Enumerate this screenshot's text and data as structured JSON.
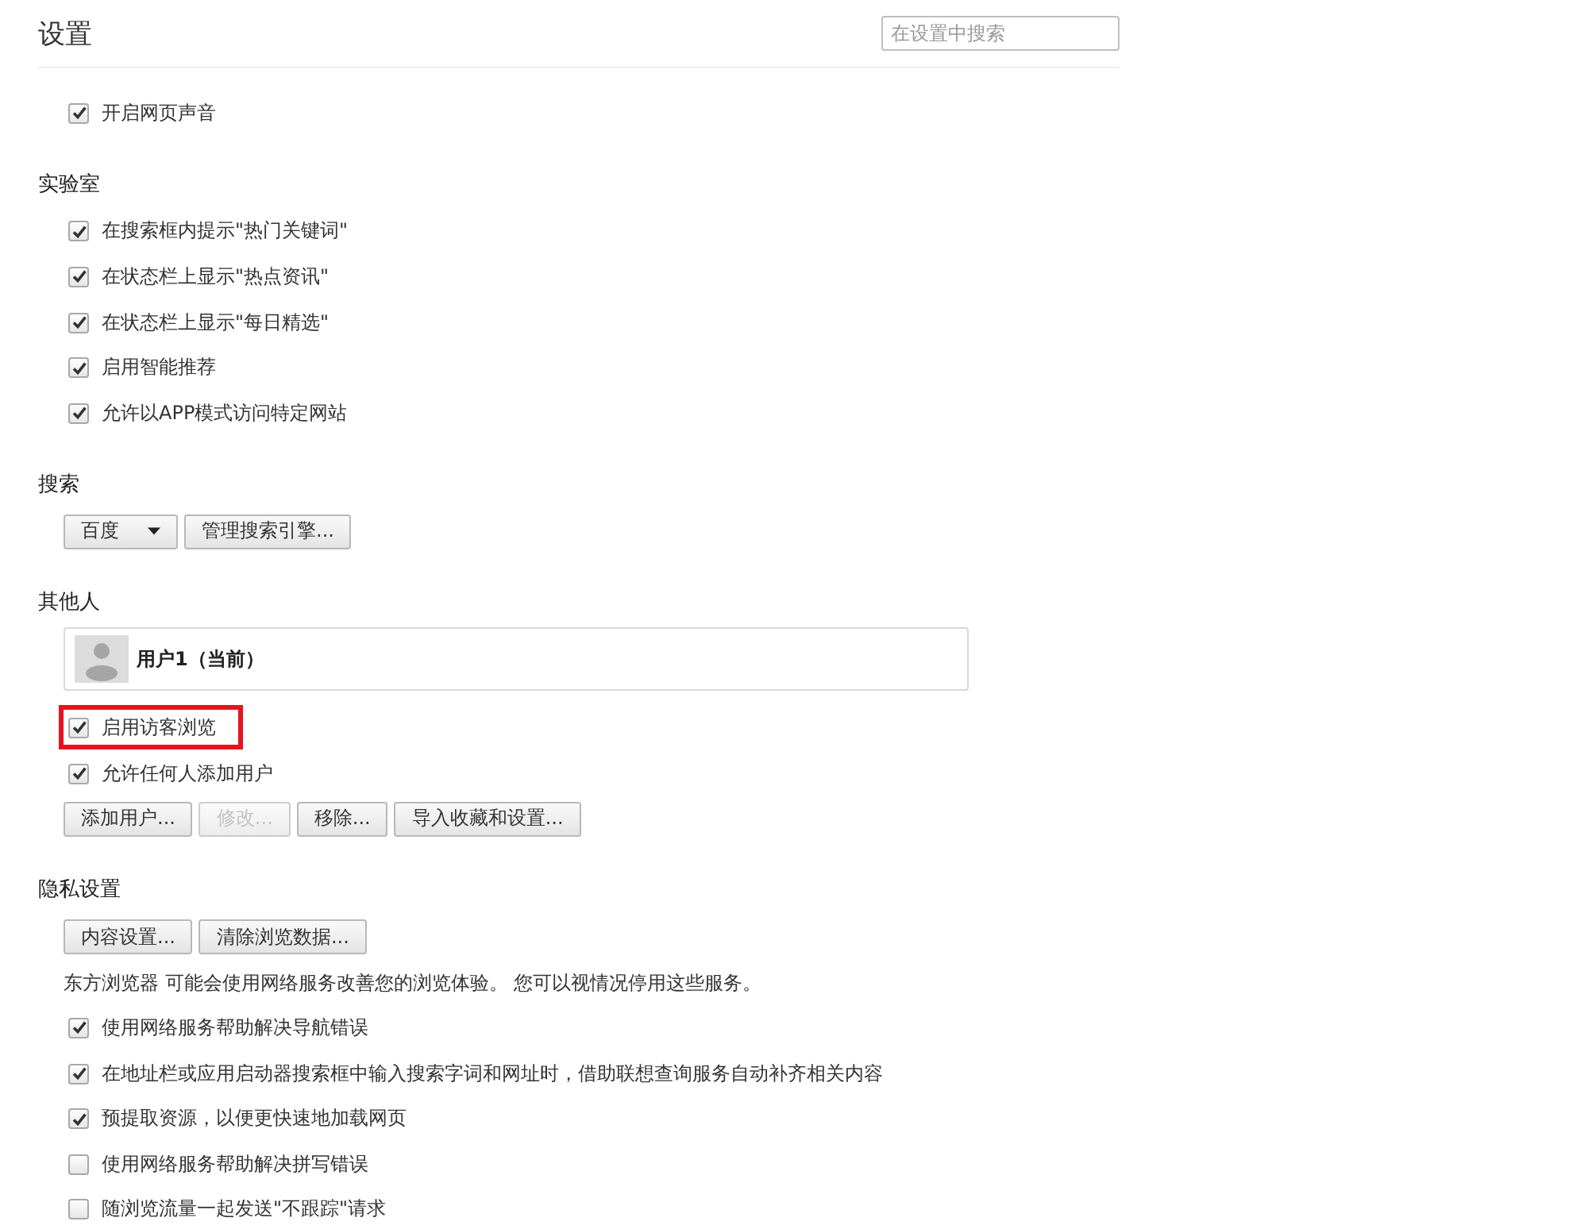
{
  "header": {
    "title": "设置",
    "search": {
      "placeholder": "在设置中搜索"
    }
  },
  "sections": [
    {
      "items": [
        {
          "kind": "checkbox",
          "label": "开启网页声音",
          "checked": true
        }
      ]
    },
    {
      "title": "实验室",
      "items": [
        {
          "kind": "checkbox",
          "label": "在搜索框内提示\"热门关键词\"",
          "checked": true
        },
        {
          "kind": "checkbox",
          "label": "在状态栏上显示\"热点资讯\"",
          "checked": true
        },
        {
          "kind": "checkbox",
          "label": "在状态栏上显示\"每日精选\"",
          "checked": true
        },
        {
          "kind": "checkbox",
          "label": "启用智能推荐",
          "checked": true
        },
        {
          "kind": "checkbox",
          "label": "允许以APP模式访问特定网站",
          "checked": true
        }
      ]
    },
    {
      "title": "搜索",
      "items": [
        {
          "kind": "buttons",
          "buttons": [
            {
              "kind": "dropdown",
              "label": "百度",
              "disabled": false
            },
            {
              "kind": "button",
              "label": "管理搜索引擎...",
              "disabled": false
            }
          ]
        }
      ]
    },
    {
      "title": "其他人",
      "items": [
        {
          "kind": "user",
          "name": "用户1（当前）"
        },
        {
          "kind": "checkbox",
          "label": "启用访客浏览",
          "checked": true,
          "highlighted": true
        },
        {
          "kind": "checkbox",
          "label": "允许任何人添加用户",
          "checked": true
        },
        {
          "kind": "buttons",
          "buttons": [
            {
              "kind": "button",
              "label": "添加用户...",
              "disabled": false
            },
            {
              "kind": "button",
              "label": "修改...",
              "disabled": true
            },
            {
              "kind": "button",
              "label": "移除...",
              "disabled": false
            },
            {
              "kind": "button",
              "label": "导入收藏和设置...",
              "disabled": false
            }
          ]
        }
      ]
    },
    {
      "title": "隐私设置",
      "items": [
        {
          "kind": "buttons",
          "buttons": [
            {
              "kind": "button",
              "label": "内容设置...",
              "disabled": false
            },
            {
              "kind": "button",
              "label": "清除浏览数据...",
              "disabled": false
            }
          ]
        },
        {
          "kind": "text",
          "text": "东方浏览器 可能会使用网络服务改善您的浏览体验。 您可以视情况停用这些服务。"
        },
        {
          "kind": "checkbox",
          "label": "使用网络服务帮助解决导航错误",
          "checked": true
        },
        {
          "kind": "checkbox",
          "label": "在地址栏或应用启动器搜索框中输入搜索字词和网址时，借助联想查询服务自动补齐相关内容",
          "checked": true
        },
        {
          "kind": "checkbox",
          "label": "预提取资源，以便更快速地加载网页",
          "checked": true
        },
        {
          "kind": "checkbox",
          "label": "使用网络服务帮助解决拼写错误",
          "checked": false
        },
        {
          "kind": "checkbox",
          "label": "随浏览流量一起发送\"不跟踪\"请求",
          "checked": false
        }
      ]
    }
  ]
}
